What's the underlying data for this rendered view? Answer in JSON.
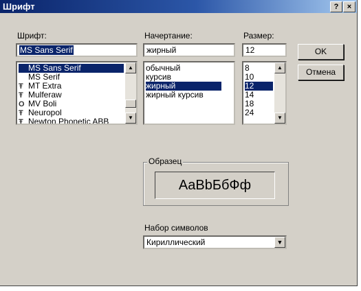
{
  "window": {
    "title": "Шрифт",
    "help_label": "?",
    "close_label": "×"
  },
  "font": {
    "label": "Шрифт:",
    "value": "MS Sans Serif",
    "items": [
      {
        "icon": "",
        "name": "MS Sans Serif"
      },
      {
        "icon": "",
        "name": "MS Serif"
      },
      {
        "icon": "Ŧ",
        "name": "MT Extra"
      },
      {
        "icon": "Ŧ",
        "name": "Mulferaw"
      },
      {
        "icon": "O",
        "name": "MV Boli"
      },
      {
        "icon": "Ŧ",
        "name": "Neuropol"
      },
      {
        "icon": "Ŧ",
        "name": "Newton Phonetic ABB"
      }
    ],
    "selected_index": 0
  },
  "style": {
    "label": "Начертание:",
    "value": "жирный",
    "items": [
      "обычный",
      "курсив",
      "жирный",
      "жирный курсив"
    ],
    "selected_index": 2
  },
  "size": {
    "label": "Размер:",
    "value": "12",
    "items": [
      "8",
      "10",
      "12",
      "14",
      "18",
      "24"
    ],
    "selected_index": 2
  },
  "buttons": {
    "ok": "OK",
    "cancel": "Отмена"
  },
  "sample": {
    "label": "Образец",
    "text": "AaBbБбФф"
  },
  "charset": {
    "label": "Набор символов",
    "value": "Кириллический"
  },
  "icons": {
    "scroll_up": "up-arrow",
    "scroll_down": "down-arrow",
    "dropdown": "chevron-down"
  }
}
